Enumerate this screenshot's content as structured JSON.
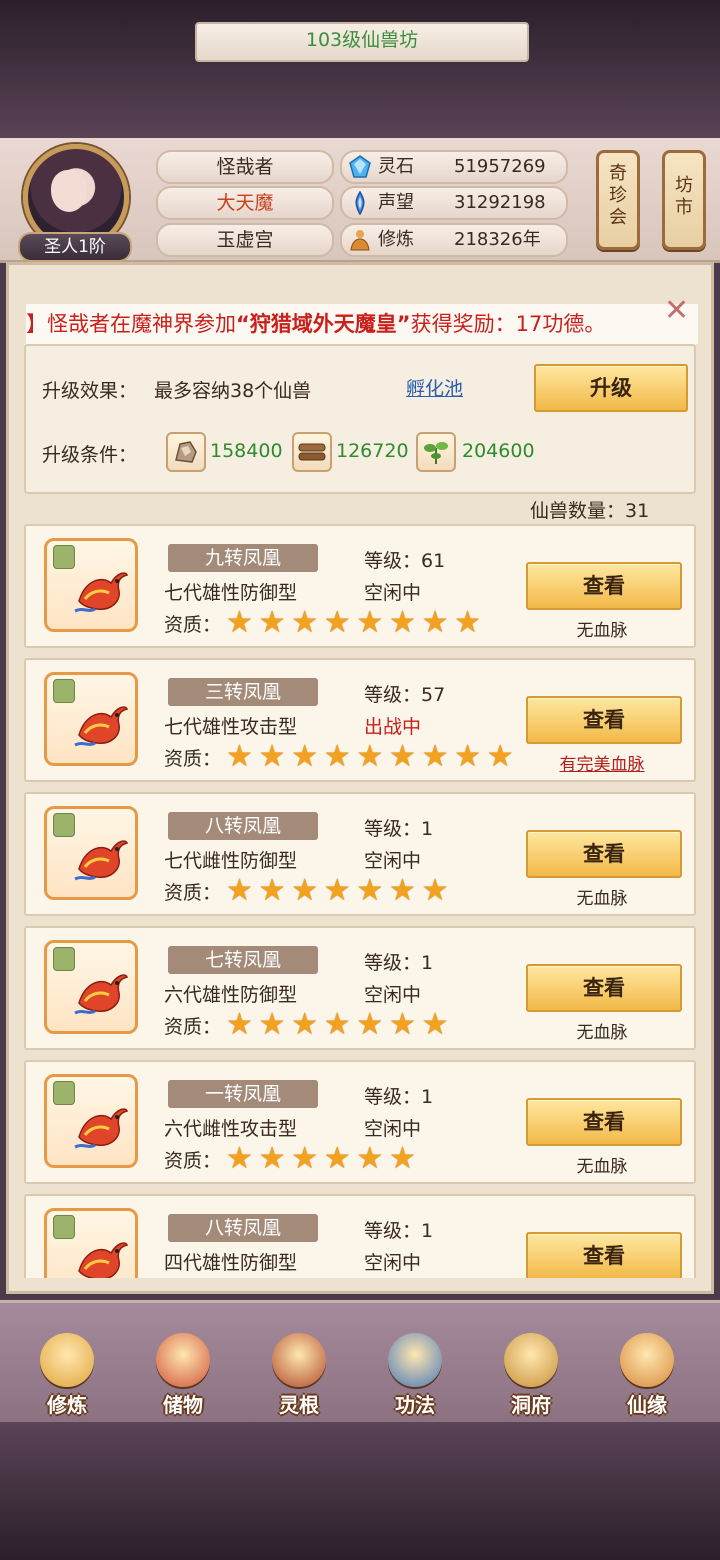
{
  "header": {
    "rank": "圣人1阶",
    "name_pills": [
      "怪哉者",
      "大天魔",
      "玉虚宫"
    ],
    "resources": [
      {
        "label": "灵石",
        "value": "51957269",
        "icon": "spirit-stone-icon"
      },
      {
        "label": "声望",
        "value": "31292198",
        "icon": "reputation-icon"
      },
      {
        "label": "修炼",
        "value": "218326年",
        "icon": "cultivation-icon"
      }
    ],
    "right_buttons": [
      {
        "label": "奇\n珍\n会"
      },
      {
        "label": "坊\n市"
      }
    ]
  },
  "panel": {
    "title": "103级仙兽坊",
    "notice": {
      "prefix": "】怪哉者在魔神界参加",
      "event": "“狩猎域外天魔皇”",
      "suffix": "获得奖励：17功德。"
    },
    "upgrade_effect_label": "升级效果：",
    "upgrade_effect_value": "最多容纳38个仙兽",
    "hatch_link": "孵化池",
    "upgrade_button": "升级",
    "upgrade_condition_label": "升级条件：",
    "materials": [
      {
        "value": "158400",
        "icon": "ore-icon"
      },
      {
        "value": "126720",
        "icon": "wood-icon"
      },
      {
        "value": "204600",
        "icon": "herb-icon"
      }
    ],
    "beast_count": "仙兽数量：31"
  },
  "beasts": [
    {
      "name": "九转凤凰",
      "level": "等级：61",
      "desc": "七代雄性防御型",
      "status": "空闲中",
      "status_color": "#3a2a22",
      "stars": 8,
      "quality_label": "资质：",
      "view": "查看",
      "blood": "无血脉",
      "perfect": false
    },
    {
      "name": "三转凤凰",
      "level": "等级：57",
      "desc": "七代雄性攻击型",
      "status": "出战中",
      "status_color": "#c8201c",
      "stars": 9,
      "quality_label": "资质：",
      "view": "查看",
      "blood": "有完美血脉",
      "perfect": true
    },
    {
      "name": "八转凤凰",
      "level": "等级：1",
      "desc": "七代雌性防御型",
      "status": "空闲中",
      "status_color": "#3a2a22",
      "stars": 7,
      "quality_label": "资质：",
      "view": "查看",
      "blood": "无血脉",
      "perfect": false
    },
    {
      "name": "七转凤凰",
      "level": "等级：1",
      "desc": "六代雄性防御型",
      "status": "空闲中",
      "status_color": "#3a2a22",
      "stars": 7,
      "quality_label": "资质：",
      "view": "查看",
      "blood": "无血脉",
      "perfect": false
    },
    {
      "name": "一转凤凰",
      "level": "等级：1",
      "desc": "六代雌性攻击型",
      "status": "空闲中",
      "status_color": "#3a2a22",
      "stars": 6,
      "quality_label": "资质：",
      "view": "查看",
      "blood": "无血脉",
      "perfect": false
    },
    {
      "name": "八转凤凰",
      "level": "等级：1",
      "desc": "四代雄性防御型",
      "status": "空闲中",
      "status_color": "#3a2a22",
      "stars": 0,
      "quality_label": "",
      "view": "查看",
      "blood": "",
      "perfect": false
    }
  ],
  "nav": [
    {
      "label": "修炼",
      "icon": "cultivate-icon"
    },
    {
      "label": "储物",
      "icon": "storage-icon"
    },
    {
      "label": "灵根",
      "icon": "spirit-root-icon"
    },
    {
      "label": "功法",
      "icon": "technique-icon"
    },
    {
      "label": "洞府",
      "icon": "cave-dwelling-icon"
    },
    {
      "label": "仙缘",
      "icon": "immortal-fate-icon"
    }
  ],
  "colors": {
    "gold_button": "#f2b948",
    "notice_red": "#c8201c",
    "material_green": "#2e8b2e",
    "link_blue": "#2a5db0"
  }
}
